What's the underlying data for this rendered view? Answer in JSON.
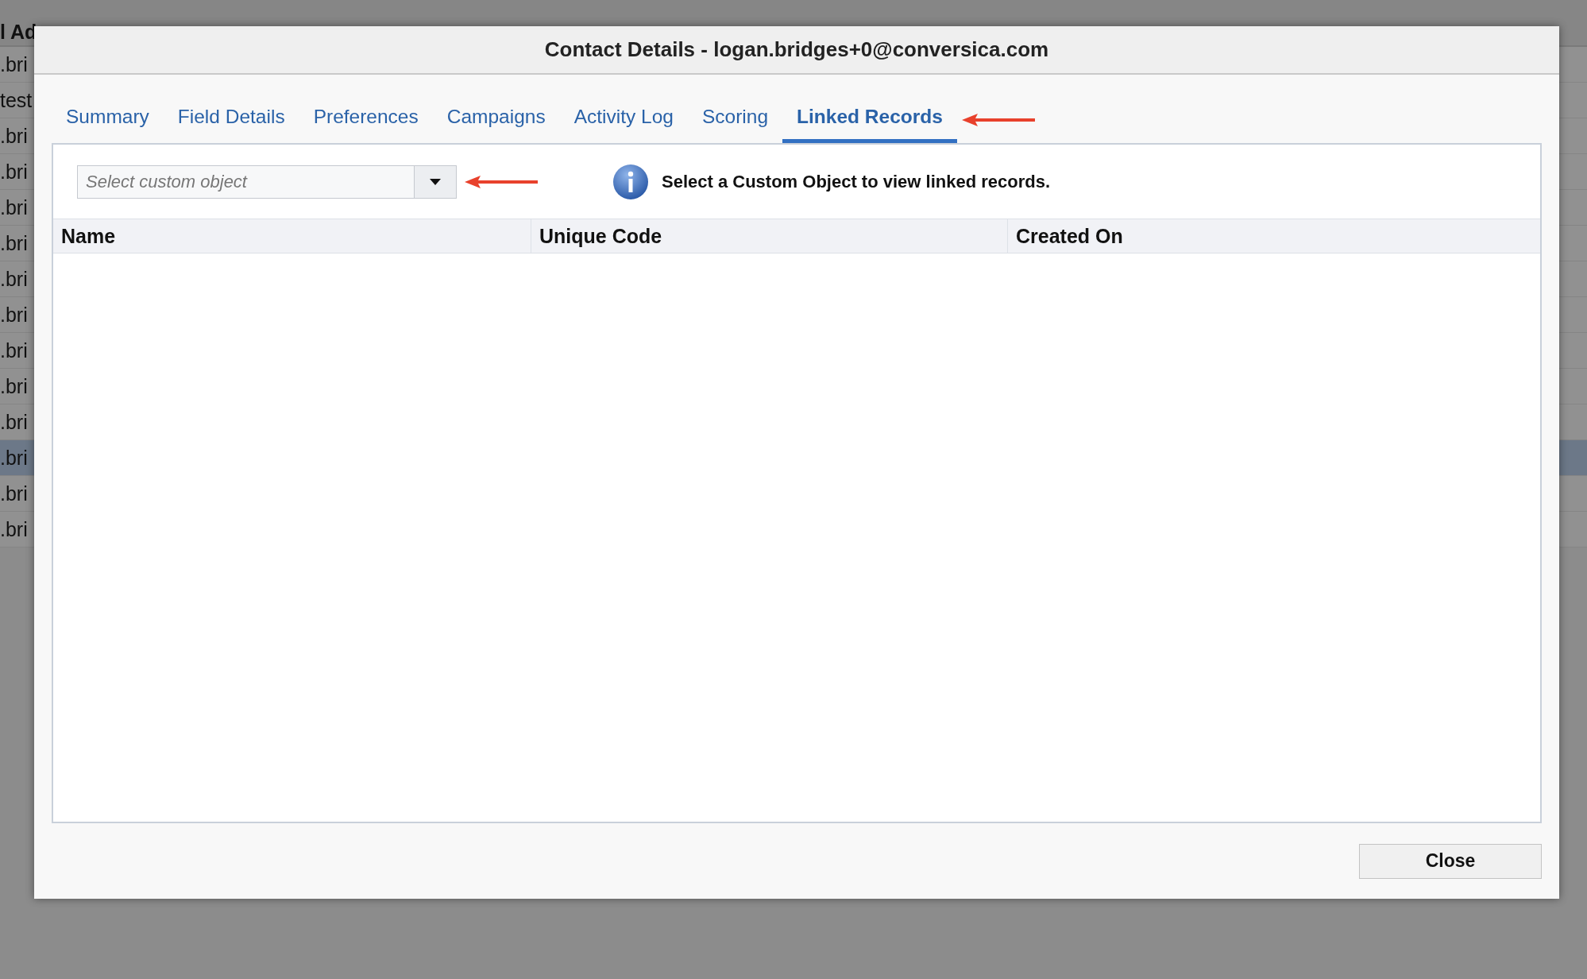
{
  "background_table": {
    "header": "l Ad",
    "rows": [
      {
        "text": ".bri",
        "selected": false
      },
      {
        "text": "test",
        "selected": false
      },
      {
        "text": ".bri",
        "selected": false
      },
      {
        "text": ".bri",
        "selected": false
      },
      {
        "text": ".bri",
        "selected": false
      },
      {
        "text": ".bri",
        "selected": false
      },
      {
        "text": ".bri",
        "selected": false
      },
      {
        "text": ".bri",
        "selected": false
      },
      {
        "text": ".bri",
        "selected": false
      },
      {
        "text": ".bri",
        "selected": false
      },
      {
        "text": ".bri",
        "selected": false
      },
      {
        "text": ".bri",
        "selected": true
      },
      {
        "text": ".bri",
        "selected": false
      },
      {
        "text": ".bri",
        "selected": false
      }
    ]
  },
  "dialog": {
    "title": "Contact Details - logan.bridges+0@conversica.com",
    "tabs": [
      {
        "label": "Summary",
        "selected": false
      },
      {
        "label": "Field Details",
        "selected": false
      },
      {
        "label": "Preferences",
        "selected": false
      },
      {
        "label": "Campaigns",
        "selected": false
      },
      {
        "label": "Activity Log",
        "selected": false
      },
      {
        "label": "Scoring",
        "selected": false
      },
      {
        "label": "Linked Records",
        "selected": true
      }
    ],
    "custom_object_select": {
      "placeholder": "Select custom object"
    },
    "info_message": "Select a Custom Object to view linked records.",
    "table": {
      "columns": [
        "Name",
        "Unique Code",
        "Created On"
      ]
    },
    "buttons": [
      "Close"
    ]
  }
}
